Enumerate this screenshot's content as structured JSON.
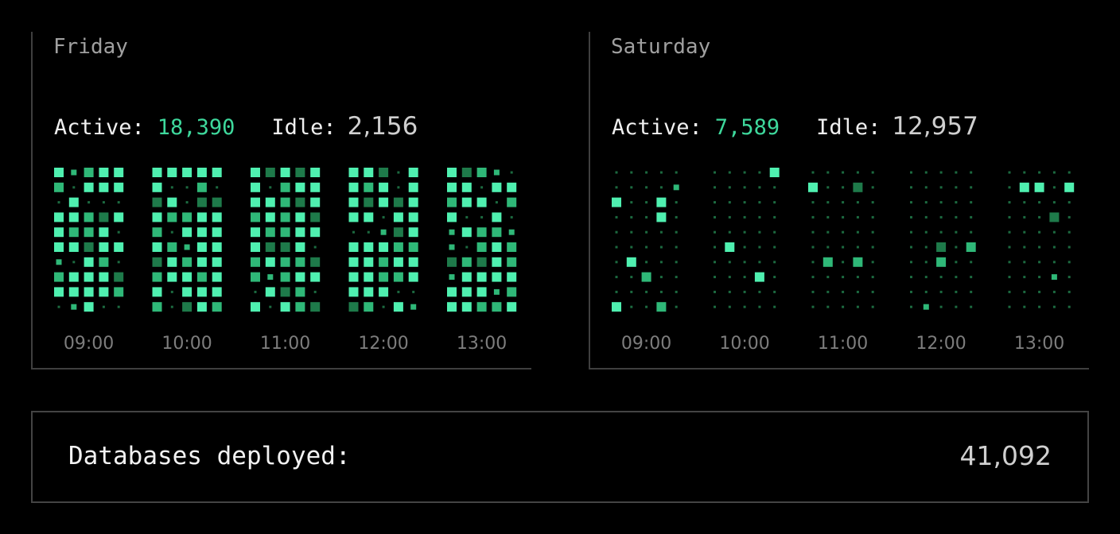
{
  "colors": {
    "active": "#3ed89c",
    "bright_cell": "#4ff0b0",
    "mid_cell": "#2fb878",
    "dim_cell": "#1e7a4a",
    "dot": "#1c6a40",
    "axis": "#3f3f3f",
    "tick_text": "#7d7d7d"
  },
  "panels": [
    {
      "day": "Friday",
      "active_label": "Active:",
      "active_value": "18,390",
      "idle_label": "Idle:",
      "idle_value": "2,156"
    },
    {
      "day": "Saturday",
      "active_label": "Active:",
      "active_value": "7,589",
      "idle_label": "Idle:",
      "idle_value": "12,957"
    }
  ],
  "footer": {
    "label": "Databases deployed:",
    "value": "41,092"
  },
  "chart_data": [
    {
      "type": "heatmap",
      "title": "Friday",
      "x_tick_labels": [
        "09:00",
        "10:00",
        "11:00",
        "12:00",
        "13:00"
      ],
      "rows": 10,
      "columns_per_hour": 5,
      "hours": 5,
      "active_density": 0.82,
      "series": [
        {
          "name": "Active",
          "value": 18390
        },
        {
          "name": "Idle",
          "value": 2156
        }
      ]
    },
    {
      "type": "heatmap",
      "title": "Saturday",
      "x_tick_labels": [
        "09:00",
        "10:00",
        "11:00",
        "12:00",
        "13:00"
      ],
      "rows": 10,
      "columns_per_hour": 5,
      "hours": 5,
      "active_density": 0.14,
      "series": [
        {
          "name": "Active",
          "value": 7589
        },
        {
          "name": "Idle",
          "value": 12957
        }
      ]
    }
  ]
}
